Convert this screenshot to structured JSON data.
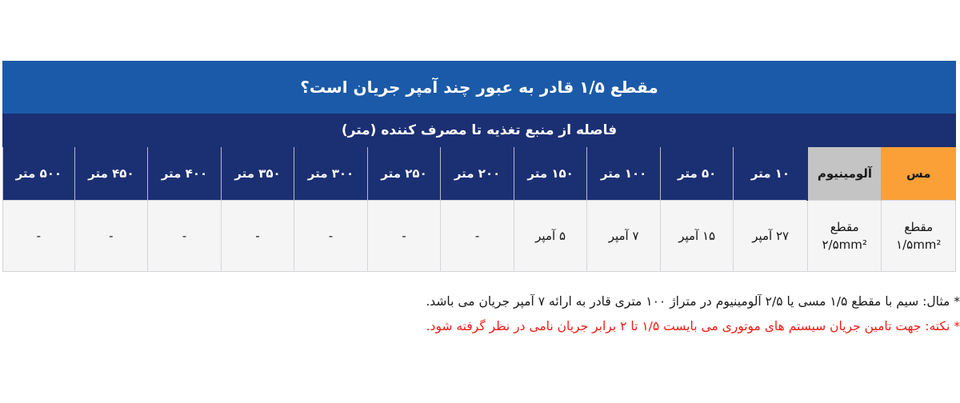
{
  "table": {
    "title": "مقطع ۱/۵ قادر به عبور چند آمپر جریان است؟",
    "subtitle": "فاصله از منبع تغذیه تا مصرف کننده  (متر)",
    "material_headers": [
      {
        "key": "copper",
        "label": "مس",
        "color": "#faa036"
      },
      {
        "key": "aluminum",
        "label": "آلومینیوم",
        "color": "#c4c4c4"
      }
    ],
    "distance_headers": [
      "۱۰ متر",
      "۵۰ متر",
      "۱۰۰ متر",
      "۱۵۰ متر",
      "۲۰۰ متر",
      "۲۵۰ متر",
      "۳۰۰ متر",
      "۳۵۰ متر",
      "۴۰۰ متر",
      "۴۵۰ متر",
      "۵۰۰ متر"
    ],
    "row": {
      "copper_section_line1": "مقطع",
      "copper_section_line2": "۱/۵mm²",
      "aluminum_section_line1": "مقطع",
      "aluminum_section_line2": "۲/۵mm²",
      "values": [
        "۲۷ آمپر",
        "۱۵ آمپر",
        "۷ آمپر",
        "۵ آمپر",
        "-",
        "-",
        "-",
        "-",
        "-",
        "-",
        "-"
      ]
    }
  },
  "notes": {
    "note_1": "* مثال: سیم با مقطع ۱/۵ مسی یا ۲/۵ آلومینیوم در متراژ ۱۰۰ متری قادر به ارائه ۷ آمپر جریان می باشد.",
    "note_2": "* نکته: جهت تامین جریان سیستم های موتوری می بایست ۱/۵ تا ۲ برابر جریان نامی در نظر گرفته شود."
  },
  "colors": {
    "title_blue": "#1b5aa8",
    "header_navy": "#1b2f73",
    "copper_orange": "#faa036",
    "aluminum_gray": "#c4c4c4",
    "cell_bg": "#f5f5f6",
    "note_red": "#ee1b13"
  }
}
